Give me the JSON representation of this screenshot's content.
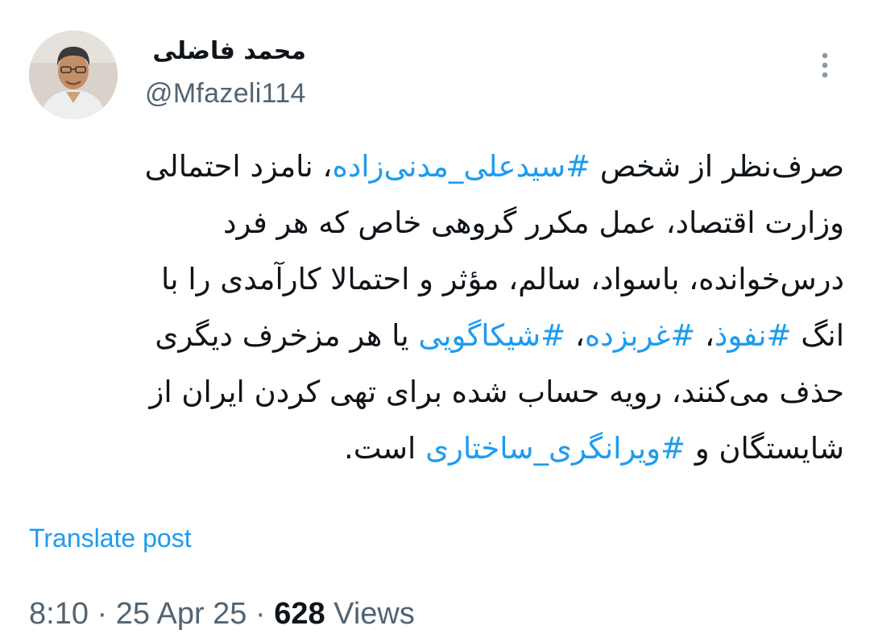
{
  "author": {
    "name": "محمد فاضلی",
    "handle": "@Mfazeli114",
    "avatar_icon": "profile-photo"
  },
  "more_icon": "more-vertical-icon",
  "tweet": {
    "lines": [
      [
        {
          "text": "صرف‌نظر از شخص ",
          "hashtag": false
        },
        {
          "text": "#سیدعلی_مدنی‌زاده",
          "hashtag": true
        },
        {
          "text": "، نامزد احتمالی",
          "hashtag": false
        }
      ],
      [
        {
          "text": "وزارت اقتصاد، عمل مکرر گروهی خاص که هر فرد",
          "hashtag": false
        }
      ],
      [
        {
          "text": "درس‌خوانده، باسواد، سالم، مؤثر و احتمالا کارآمدی را با",
          "hashtag": false
        }
      ],
      [
        {
          "text": "انگ ",
          "hashtag": false
        },
        {
          "text": "#نفوذ",
          "hashtag": true
        },
        {
          "text": "، ",
          "hashtag": false
        },
        {
          "text": "#غربزده",
          "hashtag": true
        },
        {
          "text": "، ",
          "hashtag": false
        },
        {
          "text": "#شیکاگویی",
          "hashtag": true
        },
        {
          "text": " یا هر مزخرف دیگری",
          "hashtag": false
        }
      ],
      [
        {
          "text": "حذف می‌کنند، رویه حساب شده برای تهی کردن ایران از",
          "hashtag": false
        }
      ],
      [
        {
          "text": "شایستگان و ",
          "hashtag": false
        },
        {
          "text": "#ویرانگری_ساختاری",
          "hashtag": true
        },
        {
          "text": " است.",
          "hashtag": false
        }
      ]
    ]
  },
  "translate_label": "Translate post",
  "meta": {
    "time": "8:10",
    "separator": " · ",
    "date": "25 Apr 25",
    "views_count": "628",
    "views_label": " Views"
  },
  "colors": {
    "accent": "#1d9bf0",
    "text": "#0f1419",
    "secondary": "#536471"
  }
}
